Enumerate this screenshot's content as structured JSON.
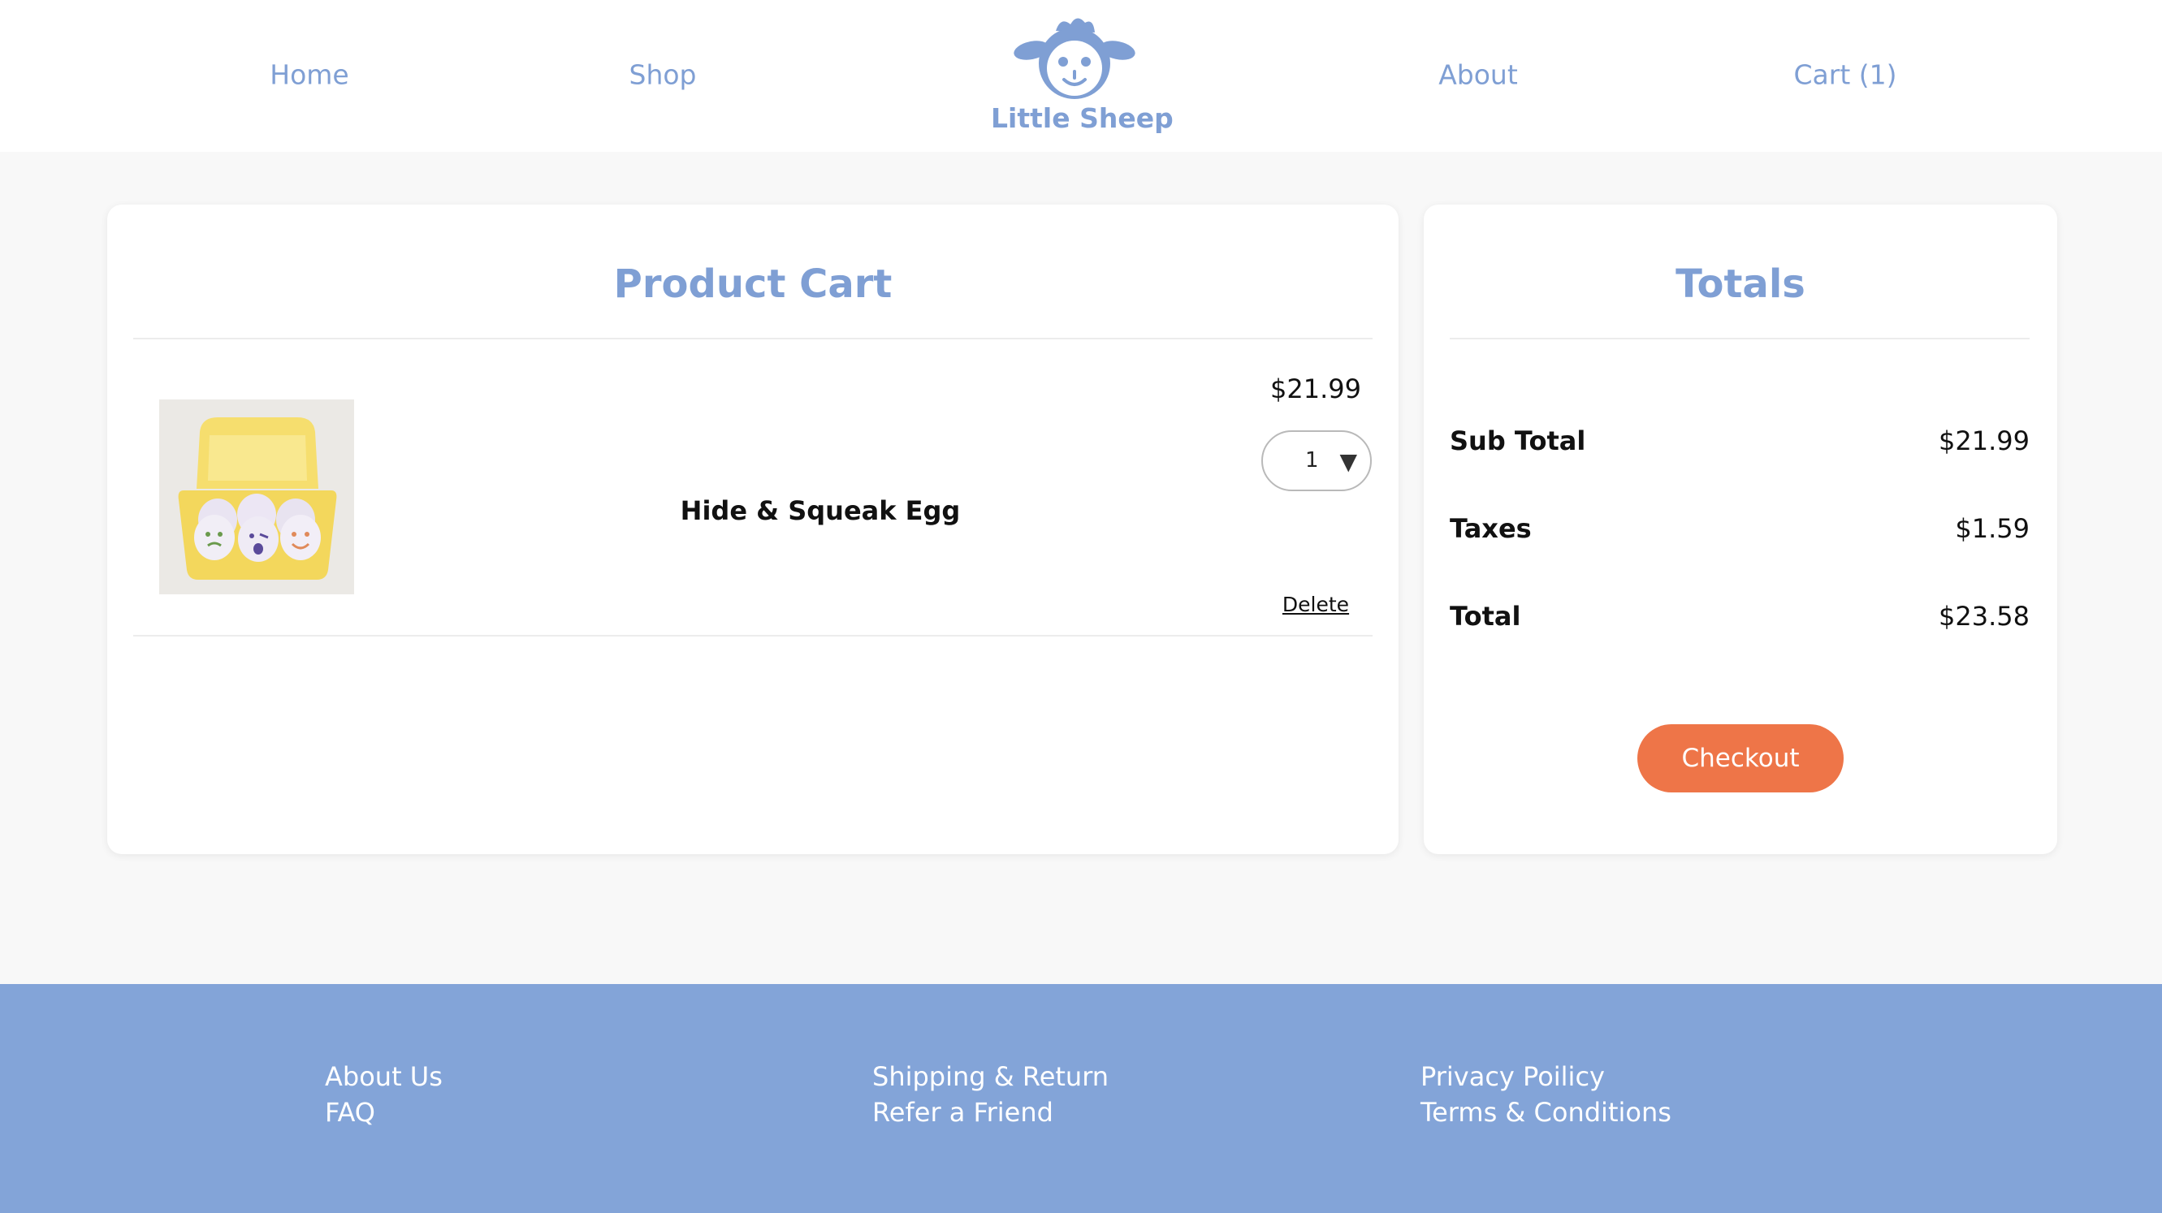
{
  "nav": {
    "home": "Home",
    "shop": "Shop",
    "about": "About",
    "cart": "Cart (1)"
  },
  "logo": {
    "text": "Little Sheep",
    "icon": "sheep-icon"
  },
  "cart": {
    "title": "Product Cart",
    "items": [
      {
        "name": "Hide & Squeak Egg",
        "price": "$21.99",
        "quantity": "1",
        "delete_label": "Delete",
        "image": "egg-carton-toy-image"
      }
    ]
  },
  "totals": {
    "title": "Totals",
    "subtotal_label": "Sub Total",
    "subtotal_value": "$21.99",
    "taxes_label": "Taxes",
    "taxes_value": "$1.59",
    "total_label": "Total",
    "total_value": "$23.58",
    "checkout_label": "Checkout"
  },
  "footer": {
    "col1": [
      "About Us",
      "FAQ"
    ],
    "col2": [
      "Shipping & Return",
      "Refer a Friend"
    ],
    "col3": [
      "Privacy Poilicy",
      "Terms & Conditions"
    ]
  },
  "colors": {
    "accent": "#7f9fd4",
    "footer_bg": "#83a4d8",
    "checkout": "#ee7548",
    "page_bg": "#f8f8f8"
  }
}
